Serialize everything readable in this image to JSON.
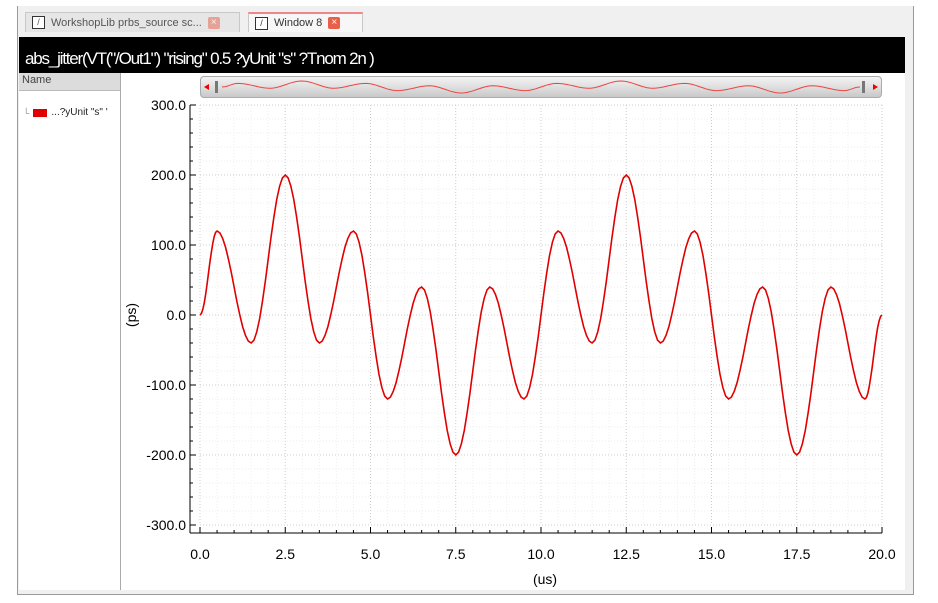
{
  "tabs": [
    {
      "label": "WorkshopLib prbs_source sc...",
      "active": false
    },
    {
      "label": "Window 8",
      "active": true
    }
  ],
  "window_title": "abs_jitter(VT(\"/Out1\") \"rising\" 0.5 ?yUnit \"s\" ?Tnom 2n )",
  "left_panel": {
    "header": "Name",
    "legend_items": [
      {
        "label": "...?yUnit \"s\" '",
        "color": "#e00000"
      }
    ]
  },
  "chart_data": {
    "type": "line",
    "title": "abs_jitter(VT(\"/Out1\") \"rising\" 0.5 ?yUnit \"s\" ?Tnom 2n )",
    "xlabel": "(us)",
    "ylabel": "(ps)",
    "xlim": [
      0,
      20
    ],
    "ylim": [
      -300,
      300
    ],
    "xticks": [
      "0.0",
      "2.5",
      "5.0",
      "7.5",
      "10.0",
      "12.5",
      "15.0",
      "17.5",
      "20.0"
    ],
    "yticks": [
      "300.0",
      "200.0",
      "100.0",
      "0.0",
      "-100.0",
      "-200.0",
      "-300.0"
    ],
    "grid": true,
    "series": [
      {
        "name": "...?yUnit \"s\" '",
        "color": "#e00000",
        "x": [
          0,
          0.5,
          1.5,
          2.5,
          3.5,
          4.5,
          5.5,
          6.5,
          7.5,
          8.5,
          9.5,
          10.5,
          11.5,
          12.5,
          13.5,
          14.5,
          15.5,
          16.5,
          17.5,
          18.5,
          19.5,
          20
        ],
        "y": [
          0,
          120,
          -40,
          200,
          -40,
          120,
          -120,
          40,
          -200,
          40,
          -120,
          120,
          -40,
          200,
          -40,
          120,
          -120,
          40,
          -200,
          40,
          -120,
          0
        ]
      }
    ]
  }
}
